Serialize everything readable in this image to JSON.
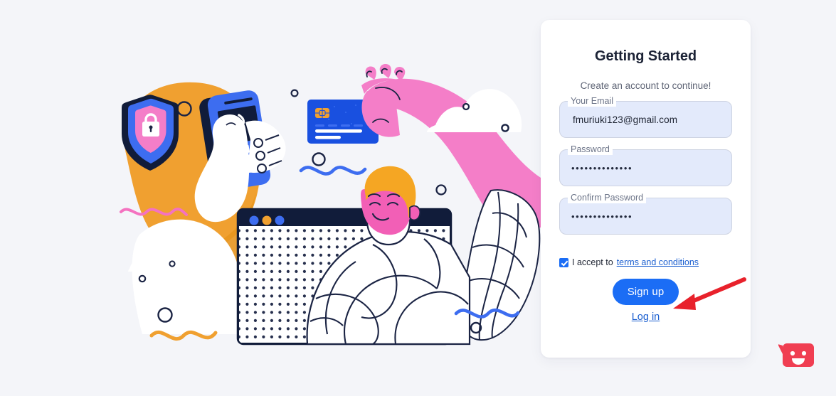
{
  "page": {
    "background_color": "#f4f5f9",
    "accent_color": "#1b6df5",
    "input_fill_color": "#e3eafb",
    "annotation_color": "#e8212b",
    "chat_color": "#f03e52"
  },
  "card": {
    "title": "Getting Started",
    "subtitle": "Create an account to continue!",
    "fields": [
      {
        "label": "Your Email",
        "value": "fmuriuki123@gmail.com",
        "placeholder": "Your Email",
        "masked": false
      },
      {
        "label": "Password",
        "value": "••••••••••••••",
        "placeholder": "Password",
        "masked": true
      },
      {
        "label": "Confirm Password",
        "value": "••••••••••••••",
        "placeholder": "Confirm Password",
        "masked": true
      }
    ],
    "terms": {
      "checked": true,
      "text": "I accept to ",
      "link_label": "terms and conditions"
    },
    "primary_button": "Sign up",
    "secondary_link": "Log in"
  },
  "illustration": {
    "name": "secure-online-payment-illustration",
    "elements": [
      "shield-lock-icon",
      "pos-terminal",
      "hand-holding-terminal",
      "credit-card",
      "pink-arm",
      "person-with-orange-hair",
      "browser-window",
      "cloud-shape",
      "orange-circle",
      "wavy-lines",
      "ring-outlines"
    ]
  },
  "annotation": {
    "type": "arrow",
    "points_to": "Sign up"
  },
  "chat_widget": {
    "icon": "smiley-chat-bubble-icon",
    "label": "Chat"
  }
}
